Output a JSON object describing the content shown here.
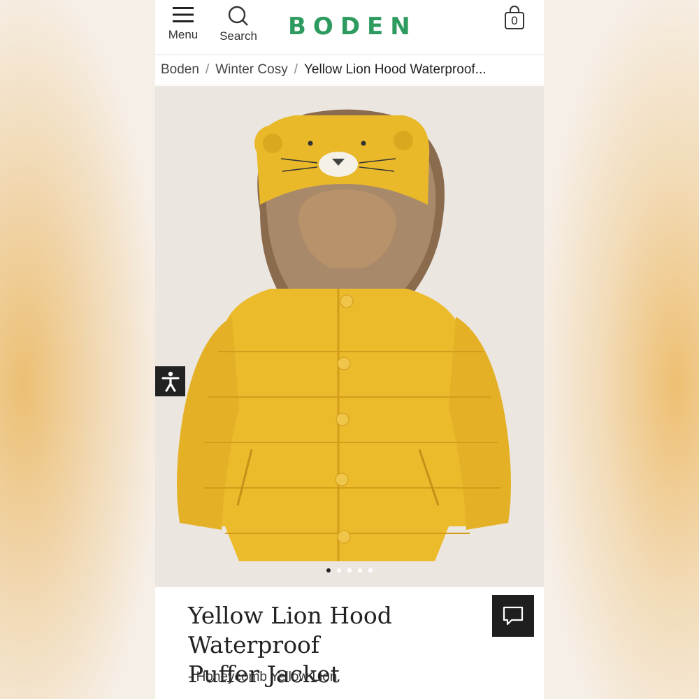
{
  "header": {
    "menu_label": "Menu",
    "search_label": "Search",
    "logo_text": "BODEN",
    "bag_count": "0",
    "brand_color": "#2d9a5f"
  },
  "breadcrumb": {
    "items": [
      "Boden",
      "Winter Cosy",
      "Yellow Lion Hood Waterproof..."
    ]
  },
  "gallery": {
    "image_alt": "Yellow lion hood puffer jacket",
    "slide_count": 5,
    "active_slide": 1
  },
  "product": {
    "title_line1": "Yellow Lion Hood Waterproof",
    "title_line2": "Puffer Jacket",
    "variant": "- Honeycomb Yellow Lion"
  },
  "icons": {
    "menu": "hamburger-icon",
    "search": "search-icon",
    "bag": "shopping-bag-icon",
    "accessibility": "accessibility-icon",
    "chat": "chat-icon"
  }
}
